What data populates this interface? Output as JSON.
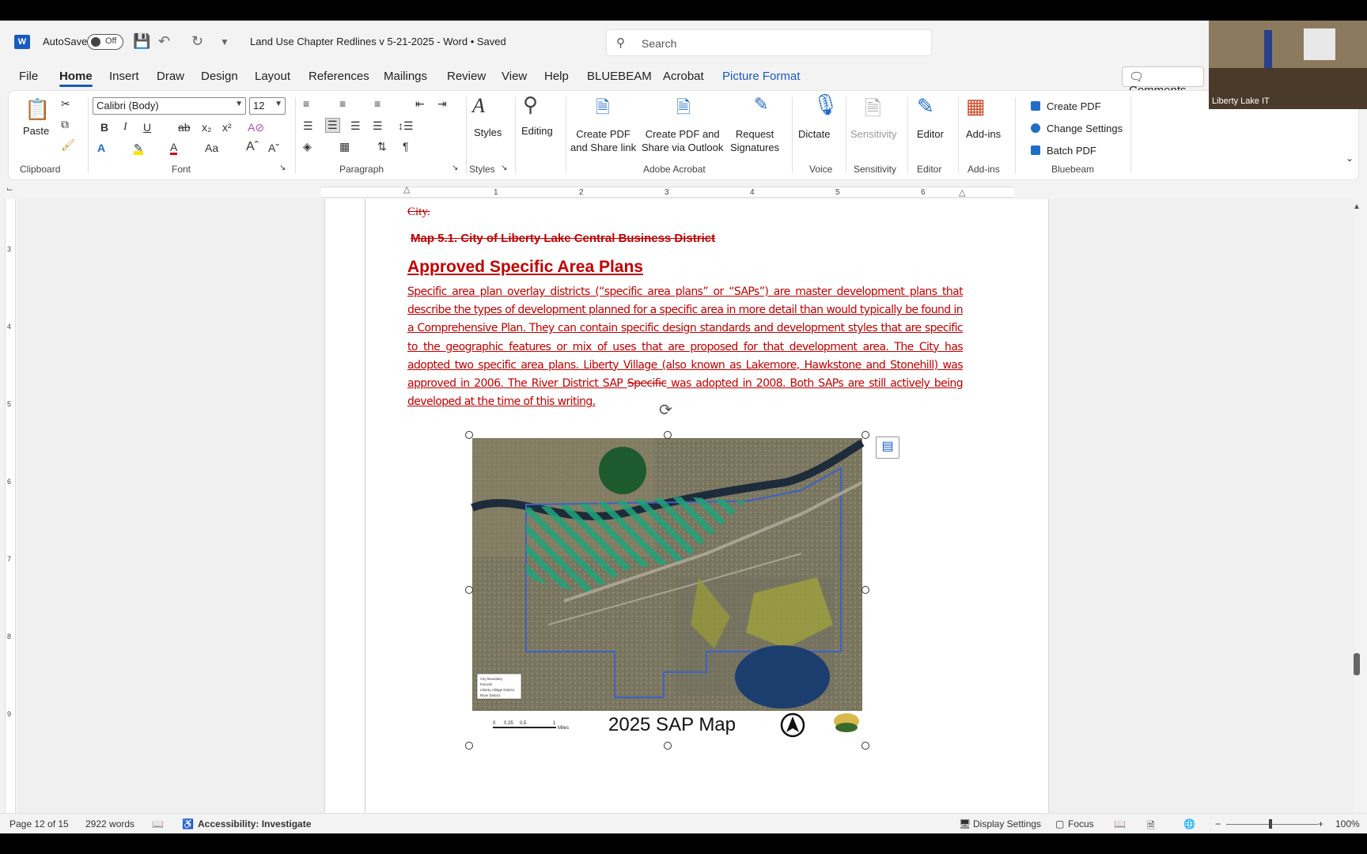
{
  "titlebar": {
    "autosave_label": "AutoSave",
    "autosave_state": "Off",
    "doc_title": "Land Use Chapter Redlines v 5-21-2025  -  Word • Saved",
    "search_placeholder": "Search"
  },
  "tabs": [
    "File",
    "Home",
    "Insert",
    "Draw",
    "Design",
    "Layout",
    "References",
    "Mailings",
    "Review",
    "View",
    "Help",
    "BLUEBEAM",
    "Acrobat",
    "Picture Format"
  ],
  "comments_label": "Comments",
  "ribbon": {
    "clipboard": {
      "paste": "Paste",
      "group": "Clipboard"
    },
    "font": {
      "name": "Calibri (Body)",
      "size": "12",
      "group": "Font"
    },
    "paragraph": {
      "group": "Paragraph"
    },
    "styles": {
      "label": "Styles",
      "group": "Styles"
    },
    "editing": {
      "label": "Editing"
    },
    "acrobat": {
      "create_pdf_share": "Create PDF\nand Share link",
      "create_pdf_outlook": "Create PDF and\nShare via Outlook",
      "request_sigs": "Request\nSignatures",
      "group": "Adobe Acrobat"
    },
    "voice": {
      "dictate": "Dictate",
      "group": "Voice"
    },
    "sensitivity": {
      "label": "Sensitivity",
      "group": "Sensitivity"
    },
    "editor": {
      "label": "Editor",
      "group": "Editor"
    },
    "addins": {
      "label": "Add-ins",
      "group": "Add-ins"
    },
    "bluebeam": {
      "create_pdf": "Create PDF",
      "change_settings": "Change Settings",
      "batch_pdf": "Batch PDF",
      "group": "Bluebeam"
    }
  },
  "document": {
    "city_text": "City.",
    "map_caption": "Map 5.1.  City of Liberty Lake Central Business District",
    "heading": "Approved Specific Area Plans",
    "paragraph_a": "Specific area plan overlay districts (“specific area plans” or “SAPs”) are master development plans that describe the types of development planned for a specific area in more detail than would typically be found in a Comprehensive Plan. They can contain specific design standards and development styles that are specific to the geographic features or mix of uses that are proposed for that development area.  The City has adopted two specific area plans.  Liberty Village (also known as Lakemore, Hawkstone and Stonehill) was approved in 2006.  The River District SAP ",
    "paragraph_strike": "Specific",
    "paragraph_b": " was adopted in 2008.  Both SAPs are still actively being developed at the time of this writing.",
    "map_title": "2025 SAP Map",
    "map_legend": [
      "City Boundary",
      "Parcels",
      "Liberty Village District",
      "River District"
    ],
    "map_scale": [
      "0",
      "0.25",
      "0.5",
      "1",
      "Miles"
    ]
  },
  "ruler_numbers": [
    "1",
    "2",
    "3",
    "4",
    "5",
    "6"
  ],
  "vruler_numbers": [
    "3",
    "4",
    "5",
    "6",
    "7",
    "8",
    "9"
  ],
  "status": {
    "page": "Page 12 of 15",
    "words": "2922 words",
    "accessibility": "Accessibility: Investigate",
    "display_settings": "Display Settings",
    "focus": "Focus",
    "zoom": "100%"
  },
  "video": {
    "label": "Liberty Lake IT"
  },
  "colors": {
    "accent": "#185abd",
    "redline": "#c00000",
    "green_hatch": "#1fa37a",
    "boundary": "#3a62c8"
  }
}
